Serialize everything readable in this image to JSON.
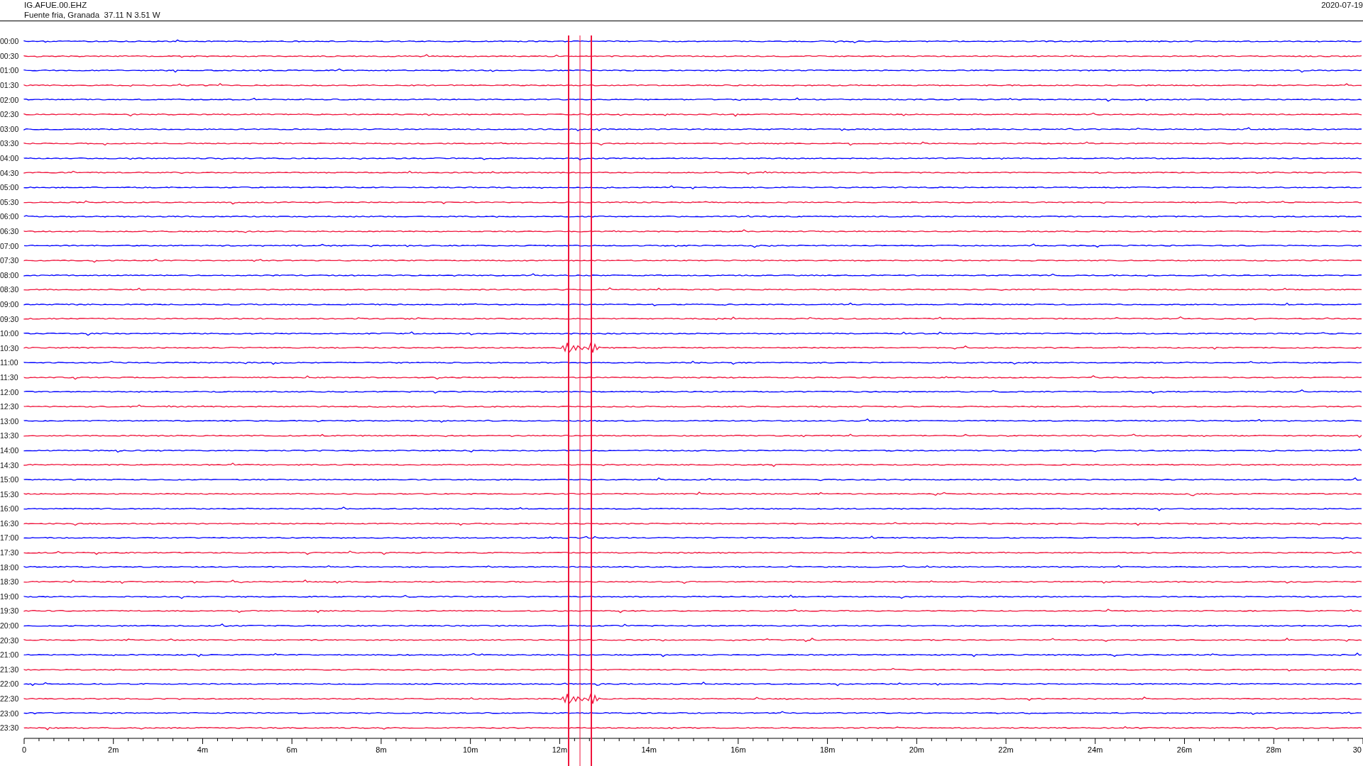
{
  "header": {
    "station": "IG.AFUE.00.EHZ",
    "location": "Fuente fria, Granada  37.11 N 3.51 W",
    "date": "2020-07-19"
  },
  "traces": [
    {
      "label": "00:00",
      "color": "#0000ff"
    },
    {
      "label": "00:30",
      "color": "#f0143c"
    },
    {
      "label": "01:00",
      "color": "#0000ff"
    },
    {
      "label": "01:30",
      "color": "#f0143c"
    },
    {
      "label": "02:00",
      "color": "#0000ff"
    },
    {
      "label": "02:30",
      "color": "#f0143c"
    },
    {
      "label": "03:00",
      "color": "#0000ff"
    },
    {
      "label": "03:30",
      "color": "#f0143c"
    },
    {
      "label": "04:00",
      "color": "#0000ff"
    },
    {
      "label": "04:30",
      "color": "#f0143c"
    },
    {
      "label": "05:00",
      "color": "#0000ff"
    },
    {
      "label": "05:30",
      "color": "#f0143c"
    },
    {
      "label": "06:00",
      "color": "#0000ff"
    },
    {
      "label": "06:30",
      "color": "#f0143c"
    },
    {
      "label": "07:00",
      "color": "#0000ff"
    },
    {
      "label": "07:30",
      "color": "#f0143c"
    },
    {
      "label": "08:00",
      "color": "#0000ff"
    },
    {
      "label": "08:30",
      "color": "#f0143c"
    },
    {
      "label": "09:00",
      "color": "#0000ff"
    },
    {
      "label": "09:30",
      "color": "#f0143c"
    },
    {
      "label": "10:00",
      "color": "#0000ff"
    },
    {
      "label": "10:30",
      "color": "#f0143c"
    },
    {
      "label": "11:00",
      "color": "#0000ff"
    },
    {
      "label": "11:30",
      "color": "#f0143c"
    },
    {
      "label": "12:00",
      "color": "#0000ff"
    },
    {
      "label": "12:30",
      "color": "#f0143c"
    },
    {
      "label": "13:00",
      "color": "#0000ff"
    },
    {
      "label": "13:30",
      "color": "#f0143c"
    },
    {
      "label": "14:00",
      "color": "#0000ff"
    },
    {
      "label": "14:30",
      "color": "#f0143c"
    },
    {
      "label": "15:00",
      "color": "#0000ff"
    },
    {
      "label": "15:30",
      "color": "#f0143c"
    },
    {
      "label": "16:00",
      "color": "#0000ff"
    },
    {
      "label": "16:30",
      "color": "#f0143c"
    },
    {
      "label": "17:00",
      "color": "#0000ff"
    },
    {
      "label": "17:30",
      "color": "#f0143c"
    },
    {
      "label": "18:00",
      "color": "#0000ff"
    },
    {
      "label": "18:30",
      "color": "#f0143c"
    },
    {
      "label": "19:00",
      "color": "#0000ff"
    },
    {
      "label": "19:30",
      "color": "#f0143c"
    },
    {
      "label": "20:00",
      "color": "#0000ff"
    },
    {
      "label": "20:30",
      "color": "#f0143c"
    },
    {
      "label": "21:00",
      "color": "#0000ff"
    },
    {
      "label": "21:30",
      "color": "#f0143c"
    },
    {
      "label": "22:00",
      "color": "#0000ff"
    },
    {
      "label": "22:30",
      "color": "#f0143c"
    },
    {
      "label": "23:00",
      "color": "#0000ff"
    },
    {
      "label": "23:30",
      "color": "#f0143c"
    }
  ],
  "x_axis": {
    "ticks": [
      "0",
      "2m",
      "4m",
      "6m",
      "8m",
      "10m",
      "12m",
      "14m",
      "16m",
      "18m",
      "20m",
      "22m",
      "24m",
      "26m",
      "28m",
      "30"
    ]
  }
}
